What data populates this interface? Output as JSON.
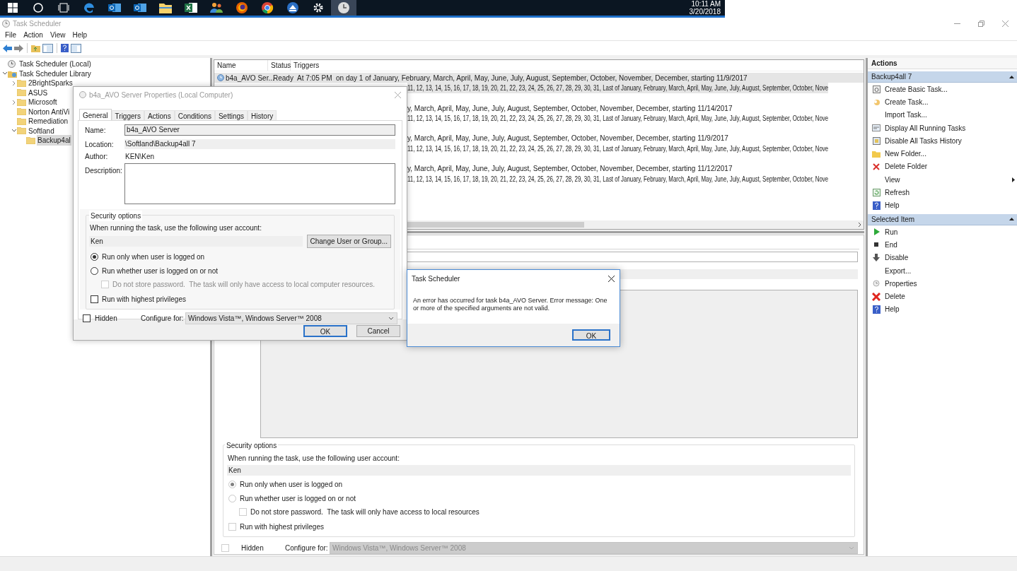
{
  "taskbar": {
    "time": "10:11 AM",
    "date": "3/20/2018"
  },
  "window": {
    "title": "Task Scheduler"
  },
  "menu": [
    "File",
    "Action",
    "View",
    "Help"
  ],
  "tree": [
    {
      "kind": "root",
      "label": "Task Scheduler (Local)",
      "selected": false
    },
    {
      "kind": "library",
      "label": "Task Scheduler Library",
      "selected": false,
      "expanded": true,
      "children": [
        {
          "kind": "folder",
          "label": "2BrightSparks",
          "selected": false,
          "expanded": false
        },
        {
          "kind": "folder",
          "label": "ASUS",
          "selected": false
        },
        {
          "kind": "folder",
          "label": "Microsoft",
          "selected": false,
          "expanded": false
        },
        {
          "kind": "folder",
          "label": "Norton AntiVi",
          "selected": false
        },
        {
          "kind": "folder",
          "label": "Remediation",
          "selected": false
        },
        {
          "kind": "folder",
          "label": "Softland",
          "selected": false,
          "expanded": true,
          "children": [
            {
              "kind": "folder",
              "label": "Backup4al",
              "selected": true
            }
          ]
        }
      ]
    }
  ],
  "task_list": {
    "columns": [
      "Name",
      "Status",
      "Triggers"
    ],
    "tasks": [
      {
        "name": "b4a_AVO Ser...",
        "status": "Ready",
        "selected": true,
        "triggers": [
          "At 7:05 PM  on day 1 of January, February, March, April, May, June, July, August, September, October, November, December, starting 11/9/2017",
          "11, 12, 13, 14, 15, 16, 17, 18, 19, 20, 21, 22, 23, 24, 25, 26, 27, 28, 29, 30, 31, Last of January, February, March, April, May, June, July, August, September, October, Nove"
        ]
      },
      {
        "selected": false,
        "triggers": [
          "y, March, April, May, June, July, August, September, October, November, December, starting 11/14/2017",
          "11, 12, 13, 14, 15, 16, 17, 18, 19, 20, 21, 22, 23, 24, 25, 26, 27, 28, 29, 30, 31, Last of January, February, March, April, May, June, July, August, September, October, Nove"
        ]
      },
      {
        "selected": false,
        "triggers": [
          "y, March, April, May, June, July, August, September, October, November, December, starting 11/9/2017",
          "11, 12, 13, 14, 15, 16, 17, 18, 19, 20, 21, 22, 23, 24, 25, 26, 27, 28, 29, 30, 31, Last of January, February, March, April, May, June, July, August, September, October, Nove"
        ]
      },
      {
        "selected": false,
        "triggers": [
          "y, March, April, May, June, July, August, September, October, November, December, starting 11/12/2017",
          "11, 12, 13, 14, 15, 16, 17, 18, 19, 20, 21, 22, 23, 24, 25, 26, 27, 28, 29, 30, 31, Last of January, February, March, April, May, June, July, August, September, October, Nove"
        ]
      }
    ]
  },
  "details": {
    "security": {
      "title": "Security options",
      "prompt": "When running the task, use the following user account:",
      "account": "Ken",
      "options": [
        {
          "label": "Run only when user is logged on",
          "selected": true
        },
        {
          "label": "Run whether user is logged on or not",
          "selected": false
        }
      ],
      "no_password": {
        "label": "Do not store password.  The task will only have access to local resources",
        "checked": false
      },
      "highest": {
        "label": "Run with highest privileges",
        "checked": false
      }
    },
    "hidden": {
      "label": "Hidden",
      "checked": false
    },
    "configure": {
      "label": "Configure for:",
      "value": "Windows Vista™, Windows Server™ 2008",
      "disabled": true
    }
  },
  "actions_panel": {
    "title": "Actions",
    "sections": [
      {
        "title": "Backup4all 7",
        "expanded": true,
        "items": [
          {
            "kind": "create_basic",
            "label": "Create Basic Task..."
          },
          {
            "kind": "create",
            "label": "Create Task..."
          },
          {
            "kind": "import",
            "label": "Import Task..."
          },
          {
            "kind": "running",
            "label": "Display All Running Tasks"
          },
          {
            "kind": "history",
            "label": "Disable All Tasks History"
          },
          {
            "kind": "new_folder",
            "label": "New Folder..."
          },
          {
            "kind": "delete_folder",
            "label": "Delete Folder"
          },
          {
            "kind": "view",
            "label": "View"
          },
          {
            "kind": "refresh",
            "label": "Refresh"
          },
          {
            "kind": "help",
            "label": "Help"
          }
        ]
      },
      {
        "title": "Selected Item",
        "expanded": true,
        "items": [
          {
            "kind": "run",
            "label": "Run"
          },
          {
            "kind": "end",
            "label": "End"
          },
          {
            "kind": "disable",
            "label": "Disable"
          },
          {
            "kind": "export",
            "label": "Export..."
          },
          {
            "kind": "properties",
            "label": "Properties"
          },
          {
            "kind": "delete",
            "label": "Delete"
          },
          {
            "kind": "help",
            "label": "Help"
          }
        ]
      }
    ]
  },
  "properties_dialog": {
    "title": "b4a_AVO Server Properties (Local Computer)",
    "tabs": [
      {
        "label": "General",
        "selected": true
      },
      {
        "label": "Triggers",
        "selected": false
      },
      {
        "label": "Actions",
        "selected": false
      },
      {
        "label": "Conditions",
        "selected": false
      },
      {
        "label": "Settings",
        "selected": false
      },
      {
        "label": "History",
        "selected": false
      }
    ],
    "name": {
      "label": "Name:",
      "value": "b4a_AVO Server"
    },
    "location": {
      "label": "Location:",
      "value": "\\Softland\\Backup4all 7"
    },
    "author": {
      "label": "Author:",
      "value": "KEN\\Ken"
    },
    "description": {
      "label": "Description:"
    },
    "security": {
      "title": "Security options",
      "prompt": "When running the task, use the following user account:",
      "account": "Ken",
      "button": "Change User or Group...",
      "options": [
        {
          "label": "Run only when user is logged on",
          "selected": true
        },
        {
          "label": "Run whether user is logged on or not",
          "selected": false
        }
      ],
      "no_password": {
        "label": "Do not store password.  The task will only have access to local computer resources.",
        "checked": false,
        "disabled": true
      },
      "highest": {
        "label": "Run with highest privileges",
        "checked": false
      }
    },
    "hidden": {
      "label": "Hidden",
      "checked": false
    },
    "configure": {
      "label": "Configure for:",
      "value": "Windows Vista™, Windows Server™ 2008"
    },
    "buttons": [
      {
        "label": "OK",
        "default": true
      },
      {
        "label": "Cancel",
        "default": false
      }
    ]
  },
  "error_dialog": {
    "title": "Task Scheduler",
    "message": "An error has occurred for task b4a_AVO Server. Error message: One or more of the specified arguments are not valid.",
    "buttons": [
      {
        "label": "OK",
        "default": true
      }
    ]
  }
}
